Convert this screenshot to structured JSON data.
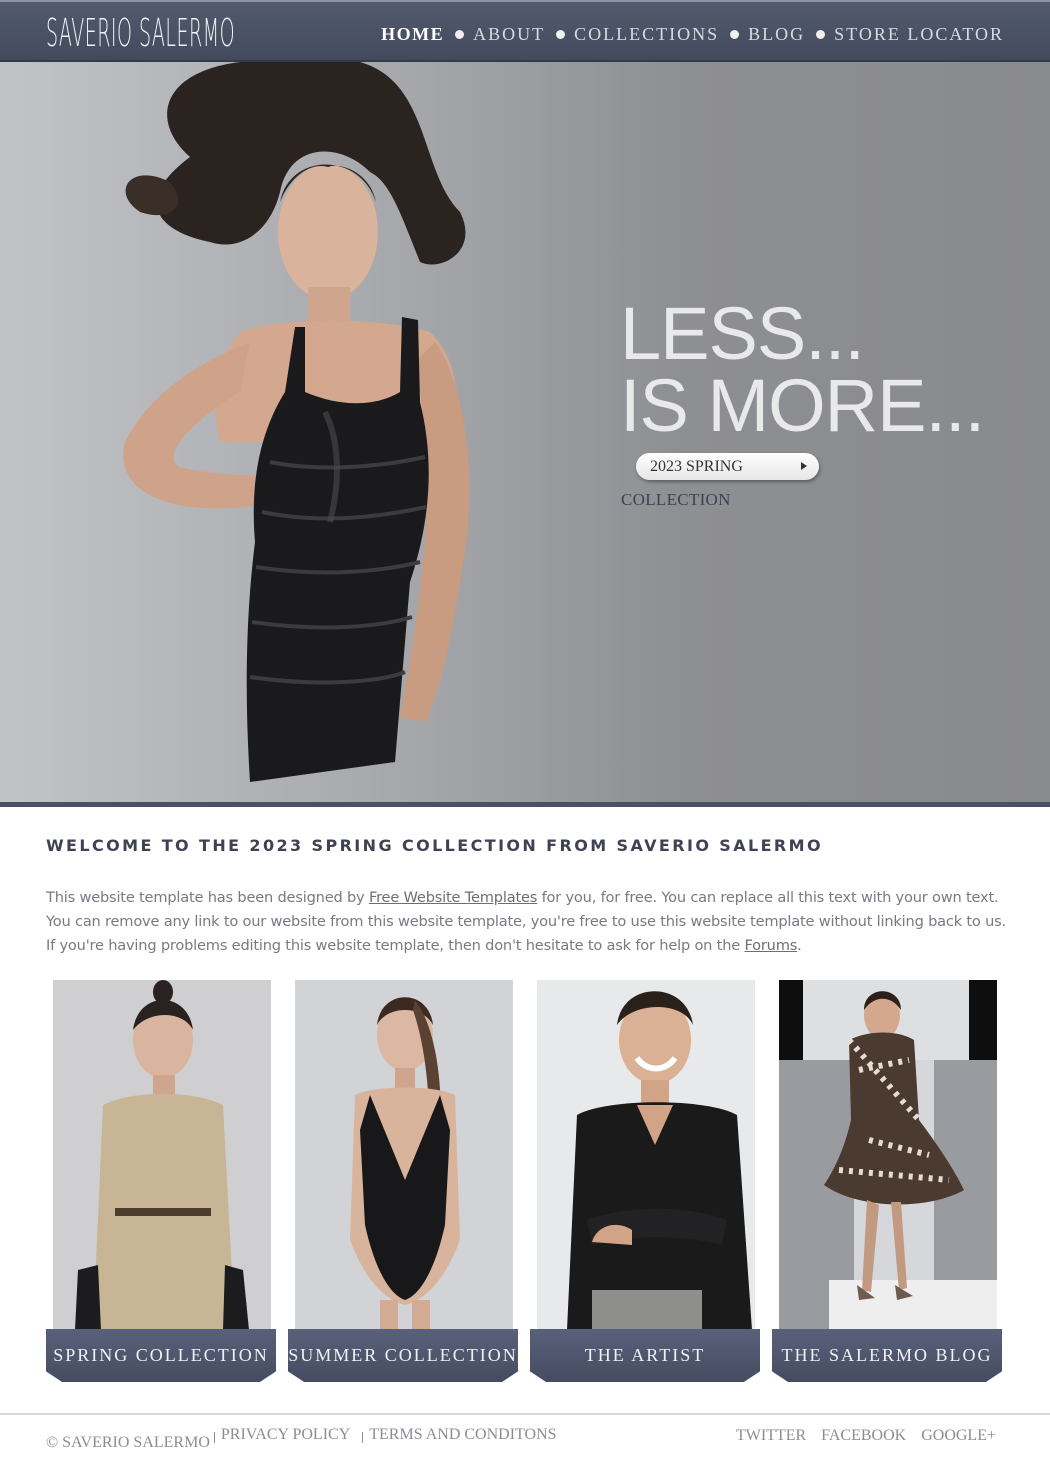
{
  "header": {
    "logo": "SAVERIO SALERMO",
    "nav": [
      "HOME",
      "ABOUT",
      "COLLECTIONS",
      "BLOG",
      "STORE LOCATOR"
    ],
    "active": "HOME"
  },
  "hero": {
    "line1": "LESS...",
    "line2": "IS MORE...",
    "button_label": "2023 SPRING",
    "subtitle": "COLLECTION"
  },
  "welcome": {
    "title": "WELCOME TO THE 2023 SPRING COLLECTION FROM SAVERIO SALERMO",
    "text_1": "This website template has been designed by ",
    "link_1": "Free Website Templates",
    "text_2": " for you, for free. You can replace all this text with your own text. You can remove any link to our website from this website template, you're free to use this website template without linking back to us. If you're having problems editing this website template, then don't hesitate to ask for help on the ",
    "link_2": "Forums",
    "text_3": "."
  },
  "cards": [
    {
      "label": "SPRING COLLECTION"
    },
    {
      "label": "SUMMER COLLECTION"
    },
    {
      "label": "THE ARTIST"
    },
    {
      "label": "THE SALERMO BLOG"
    }
  ],
  "footer": {
    "copyright": "© SAVERIO SALERMO",
    "links": [
      "PRIVACY POLICY",
      "TERMS AND CONDITONS"
    ],
    "social": [
      "TWITTER",
      "FACEBOOK",
      "GOOGLE+"
    ]
  },
  "colors": {
    "header": "#4a5166",
    "card_tab": "#4f566d",
    "hero_text": "#e9e9ea"
  }
}
